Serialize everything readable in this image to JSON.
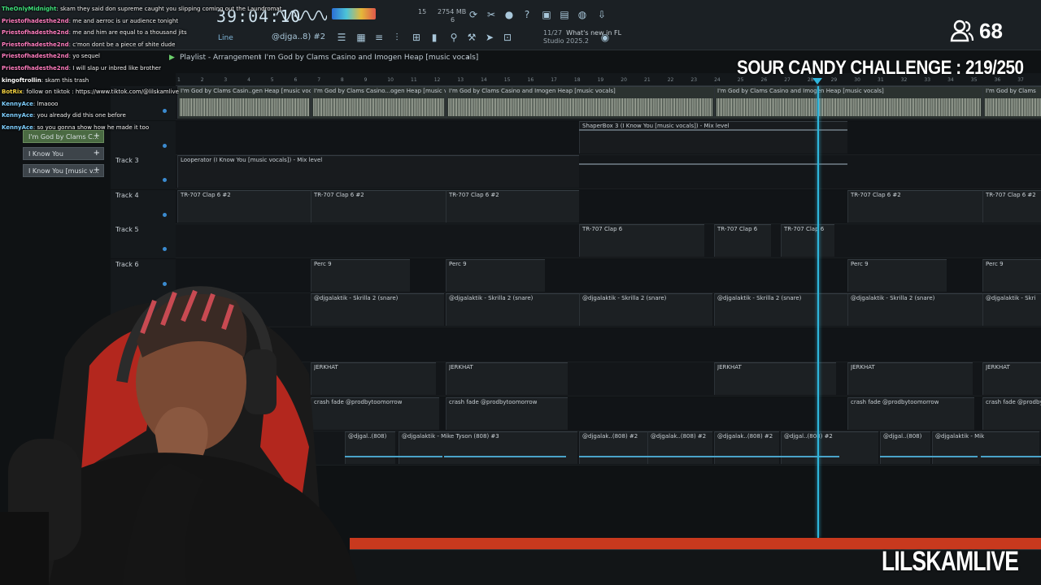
{
  "toolbar": {
    "time": "39:04:10",
    "cpu": "15",
    "memory": "2754 MB",
    "voices": "6",
    "snap_label": "Line",
    "pattern": "@djga..8) #2",
    "news_date": "11/27",
    "news_title": "What's new in FL",
    "news_sub": "Studio 2025.2"
  },
  "playlist": {
    "label": "Playlist - Arrangement",
    "song": "I'm God by Clams Casino and Imogen Heap [music vocals]"
  },
  "ruler_ticks": [
    "1",
    "2",
    "3",
    "4",
    "5",
    "6",
    "7",
    "8",
    "9",
    "10",
    "11",
    "12",
    "13",
    "14",
    "15",
    "16",
    "17",
    "18",
    "19",
    "20",
    "21",
    "22",
    "23",
    "24",
    "25",
    "26",
    "27",
    "28",
    "29",
    "30",
    "31",
    "32",
    "33",
    "34",
    "35",
    "36",
    "37"
  ],
  "picker": [
    {
      "label": "I'm God by Clams C...",
      "active": true
    },
    {
      "label": "I Know You",
      "active": false
    },
    {
      "label": "I Know You [music v...",
      "active": false
    }
  ],
  "tracks": [
    {
      "name": "",
      "clips": [
        "I'm God by Clams Casin..gen Heap [music vocals]",
        "I'm God by Clams Casino...ogen Heap [music vocals]",
        "I'm God by Clams Casino and Imogen Heap [music vocals]",
        "I'm God by Clams Casino and Imogen Heap [music vocals]",
        "I'm God by Clams"
      ]
    },
    {
      "name": "",
      "clips": [
        "ShaperBox 3 (I Know You [music vocals]) - Mix level"
      ]
    },
    {
      "name": "Track 3",
      "clips": [
        "Looperator (I Know You [music vocals]) - Mix level"
      ]
    },
    {
      "name": "Track 4",
      "clips": [
        "TR-707 Clap 6 #2",
        "TR-707 Clap 6 #2",
        "TR-707 Clap 6 #2",
        "TR-707 Clap 6 #2",
        "TR-707 Clap 6 #2"
      ]
    },
    {
      "name": "Track 5",
      "clips": [
        "TR-707 Clap 6",
        "TR-707 Clap 6",
        "TR-707 Clap 6"
      ]
    },
    {
      "name": "Track 6",
      "clips": [
        "Perc 9",
        "Perc 9",
        "Perc 9",
        "Perc 9"
      ]
    },
    {
      "name": "",
      "clips": [
        "@djgalaktik - Skrilla 2 (snare)",
        "@djgalaktik - Skrilla 2 (snare)",
        "@djgalaktik - Skrilla 2 (snare)",
        "@djgalaktik - Skrilla 2 (snare)",
        "@djgalaktik - Skrilla 2 (snare)",
        "@djgalaktik - Skri"
      ]
    },
    {
      "name": "",
      "clips": []
    },
    {
      "name": "",
      "clips": [
        "JERKHAT",
        "JERKHAT",
        "JERKHAT",
        "JERKHAT",
        "JERKHAT"
      ]
    },
    {
      "name": "",
      "clips": [
        "crash fade @prodbytoomorrow",
        "crash fade @prodbytoomorrow",
        "crash fade @prodbytoomorrow",
        "crash fade @prodbytoomorrow"
      ]
    },
    {
      "name": "",
      "clips": [
        "@djgal..(808)",
        "@djgalaktik - Mike Tyson (808) #3",
        "@djgalak..(808) #2",
        "@djgalak..(808) #2",
        "@djgalak..(808) #2",
        "@djgal..(808) #2",
        "@djgal..(808)",
        "@djgalaktik - Mik"
      ]
    }
  ],
  "chat": [
    {
      "user": "TheOnlyMidnight",
      "color": "#3ee07a",
      "msg": ": skam they said don supreme caught you slipping coming out the Laundromat"
    },
    {
      "user": "Priestofhadesthe2nd",
      "color": "#ff7dbf",
      "msg": ": me and aerroc is ur audience tonight"
    },
    {
      "user": "Priestofhadesthe2nd",
      "color": "#ff7dbf",
      "msg": ": me and him are equal to a thousand jits"
    },
    {
      "user": "Priestofhadesthe2nd",
      "color": "#ff7dbf",
      "msg": ": c'mon dont be a piece of shite dude"
    },
    {
      "user": "Priestofhadesthe2nd",
      "color": "#ff7dbf",
      "msg": ": yo sequel"
    },
    {
      "user": "Priestofhadesthe2nd",
      "color": "#ff7dbf",
      "msg": ": I will slap ur inbred like brother"
    },
    {
      "user": "kingoftrollin",
      "color": "#ffffff",
      "msg": ": skam this trash"
    },
    {
      "user": "BotRix",
      "color": "#f5d442",
      "msg": ": follow on tiktok : https://www.tiktok.com/@lilskamlive"
    },
    {
      "user": "KennyAce",
      "color": "#7fd0ff",
      "msg": ": lmaooo"
    },
    {
      "user": "KennyAce",
      "color": "#7fd0ff",
      "msg": ": you already did this one before"
    },
    {
      "user": "KennyAce",
      "color": "#7fd0ff",
      "msg": ": so you gonna show how he made it too"
    }
  ],
  "stream": {
    "viewer_count": "68",
    "challenge": "SOUR CANDY CHALLENGE : 219/250",
    "handle": "LILSKAMLIVE"
  },
  "icons": [
    "users-icon",
    "metronome-icon",
    "record-icon",
    "mixer-icon",
    "piano-roll-icon",
    "browser-icon",
    "plugin-icon",
    "help-icon"
  ],
  "colors": {
    "playhead": "#2fb6dc",
    "bottom_bar": "#c8391e",
    "track_bg": "#131619"
  }
}
